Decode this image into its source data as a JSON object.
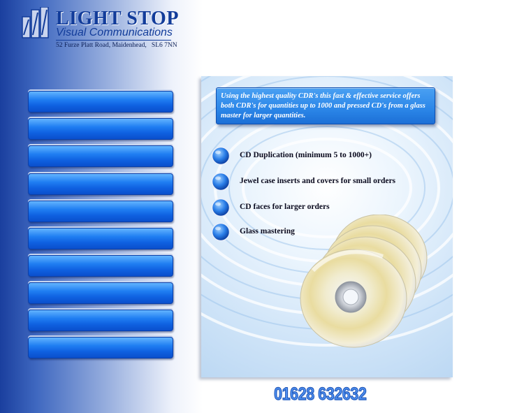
{
  "brand": {
    "title": "LIGHT STOP",
    "subtitle": "Visual Communications",
    "address": "52 Furze Platt Road, Maidenhead,   SL6 7NN"
  },
  "nav": {
    "button_count": 10,
    "item_labels": [
      "",
      "",
      "",
      "",
      "",
      "",
      "",
      "",
      "",
      ""
    ]
  },
  "content": {
    "intro": "Using the highest quality CDR's this fast & effective service offers both CDR's for quantities up to 1000 and pressed CD's from a glass master for larger quantities.",
    "services": [
      "CD Duplication (minimum 5 to 1000+)",
      "Jewel case inserts and covers for small orders",
      "CD faces for larger orders",
      "Glass mastering"
    ]
  },
  "phone": "01628 632632",
  "colors": {
    "brand_blue": "#123c9a",
    "button_blue": "#1f7ef2",
    "panel_blue": "#cfe4f8"
  }
}
